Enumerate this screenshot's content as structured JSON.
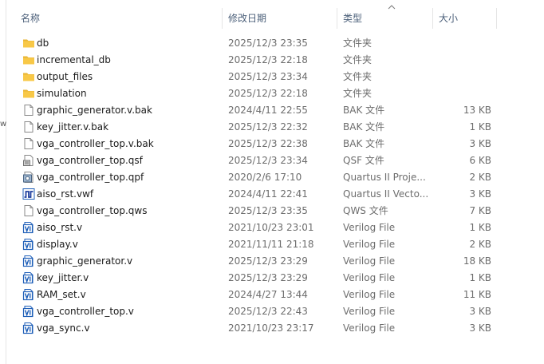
{
  "columns": {
    "name": "名称",
    "modified": "修改日期",
    "type": "类型",
    "size": "大小"
  },
  "edge_glyph": "w",
  "files": [
    {
      "name": "db",
      "modified": "2025/12/3 23:35",
      "type": "文件夹",
      "size": "",
      "icon": "folder-icon"
    },
    {
      "name": "incremental_db",
      "modified": "2025/12/3 22:18",
      "type": "文件夹",
      "size": "",
      "icon": "folder-icon"
    },
    {
      "name": "output_files",
      "modified": "2025/12/3 23:34",
      "type": "文件夹",
      "size": "",
      "icon": "folder-icon"
    },
    {
      "name": "simulation",
      "modified": "2025/12/3 22:18",
      "type": "文件夹",
      "size": "",
      "icon": "folder-icon"
    },
    {
      "name": "graphic_generator.v.bak",
      "modified": "2024/4/11 22:55",
      "type": "BAK 文件",
      "size": "13 KB",
      "icon": "blank-file-icon"
    },
    {
      "name": "key_jitter.v.bak",
      "modified": "2025/12/3 22:32",
      "type": "BAK 文件",
      "size": "1 KB",
      "icon": "blank-file-icon"
    },
    {
      "name": "vga_controller_top.v.bak",
      "modified": "2025/12/3 22:38",
      "type": "BAK 文件",
      "size": "3 KB",
      "icon": "blank-file-icon"
    },
    {
      "name": "vga_controller_top.qsf",
      "modified": "2025/12/3 23:34",
      "type": "QSF 文件",
      "size": "6 KB",
      "icon": "qsf-file-icon"
    },
    {
      "name": "vga_controller_top.qpf",
      "modified": "2020/2/6 17:10",
      "type": "Quartus II Proje...",
      "size": "2 KB",
      "icon": "quartus-project-icon"
    },
    {
      "name": "aiso_rst.vwf",
      "modified": "2024/4/11 22:41",
      "type": "Quartus II Vecto...",
      "size": "3 KB",
      "icon": "waveform-file-icon"
    },
    {
      "name": "vga_controller_top.qws",
      "modified": "2025/12/3 23:35",
      "type": "QWS 文件",
      "size": "7 KB",
      "icon": "blank-file-icon"
    },
    {
      "name": "aiso_rst.v",
      "modified": "2021/10/23 23:01",
      "type": "Verilog File",
      "size": "1 KB",
      "icon": "verilog-file-icon"
    },
    {
      "name": "display.v",
      "modified": "2021/11/11 21:18",
      "type": "Verilog File",
      "size": "2 KB",
      "icon": "verilog-file-icon"
    },
    {
      "name": "graphic_generator.v",
      "modified": "2025/12/3 23:29",
      "type": "Verilog File",
      "size": "18 KB",
      "icon": "verilog-file-icon"
    },
    {
      "name": "key_jitter.v",
      "modified": "2025/12/3 23:29",
      "type": "Verilog File",
      "size": "1 KB",
      "icon": "verilog-file-icon"
    },
    {
      "name": "RAM_set.v",
      "modified": "2024/4/27 13:44",
      "type": "Verilog File",
      "size": "11 KB",
      "icon": "verilog-file-icon"
    },
    {
      "name": "vga_controller_top.v",
      "modified": "2025/12/3 22:43",
      "type": "Verilog File",
      "size": "3 KB",
      "icon": "verilog-file-icon"
    },
    {
      "name": "vga_sync.v",
      "modified": "2021/10/23 23:17",
      "type": "Verilog File",
      "size": "3 KB",
      "icon": "verilog-file-icon"
    }
  ],
  "colors": {
    "header_text": "#4c607a",
    "folder": "#f8c847",
    "verilog_blue": "#1f5fb8",
    "secondary_text": "#6d6d6d"
  }
}
